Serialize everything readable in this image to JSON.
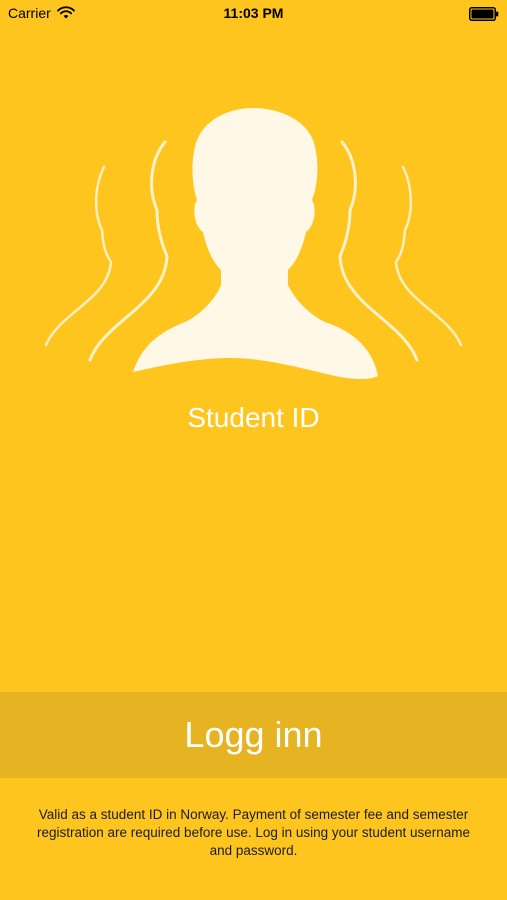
{
  "status_bar": {
    "carrier": "Carrier",
    "time": "11:03 PM",
    "wifi_icon": "wifi-icon",
    "battery_icon": "battery-icon"
  },
  "hero": {
    "icon": "people-silhouette-icon"
  },
  "app": {
    "title": "Student ID"
  },
  "login": {
    "label": "Logg inn"
  },
  "disclaimer": {
    "text": "Valid as a student ID in Norway. Payment of semester fee and semester registration are required before use. Log in using your student username and password."
  },
  "colors": {
    "background": "#FDC51E",
    "login_bar": "#E6B322",
    "silhouette": "#FFF8E6"
  }
}
